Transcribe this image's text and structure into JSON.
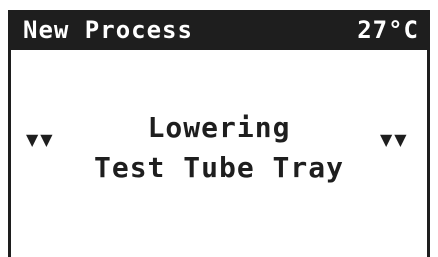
{
  "header": {
    "title": "New Process",
    "temperature": "27°C"
  },
  "message": {
    "line1": "Lowering",
    "line2": "Test Tube Tray"
  },
  "indicators": {
    "left_glyph": "▼▼",
    "right_glyph": "▼▼",
    "icon_name": "down-arrow-icon"
  },
  "colors": {
    "foreground": "#1e1e1e",
    "background": "#ffffff"
  }
}
